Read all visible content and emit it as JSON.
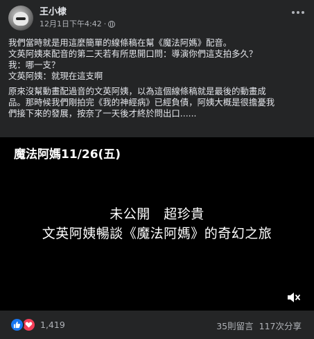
{
  "post": {
    "author": "王小棣",
    "timestamp": "12月1日下午4:42",
    "separator": "·",
    "privacy_icon": "globe-icon",
    "more_icon": "more-horizontal-icon"
  },
  "body": {
    "lines": [
      "我們當時就是用這麼簡單的線條稿在幫《魔法阿媽》配音。",
      "文英阿姨來配音的第二天若有所思開口問：導演你們這支拍多久？",
      "我：哪一支？",
      "文英阿姨：就現在這支啊"
    ],
    "paragraph2": [
      "原來沒幫動畫配過音的文英阿姨，以為這個線條稿就是最後的動畫成",
      "品。那時候我們剛拍完《我的神經病》已經負債，阿姨大概是很擔憂我",
      "們接下來的發展，按奈了一天後才終於問出口......"
    ]
  },
  "video": {
    "title": "魔法阿媽11/26(五)",
    "caption_line1": "未公開　超珍貴",
    "caption_line2": "文英阿姨暢談《魔法阿媽》的奇幻之旅",
    "mute_icon": "volume-muted-icon"
  },
  "footer": {
    "reaction_count": "1,419",
    "comments": "35則留言",
    "shares": "117次分享",
    "reaction_icons": [
      "like-icon",
      "love-icon"
    ]
  },
  "colors": {
    "background": "#242526",
    "text": "#e4e6eb",
    "secondary": "#b0b3b8",
    "like": "#1877f2",
    "love": "#f33e58"
  }
}
